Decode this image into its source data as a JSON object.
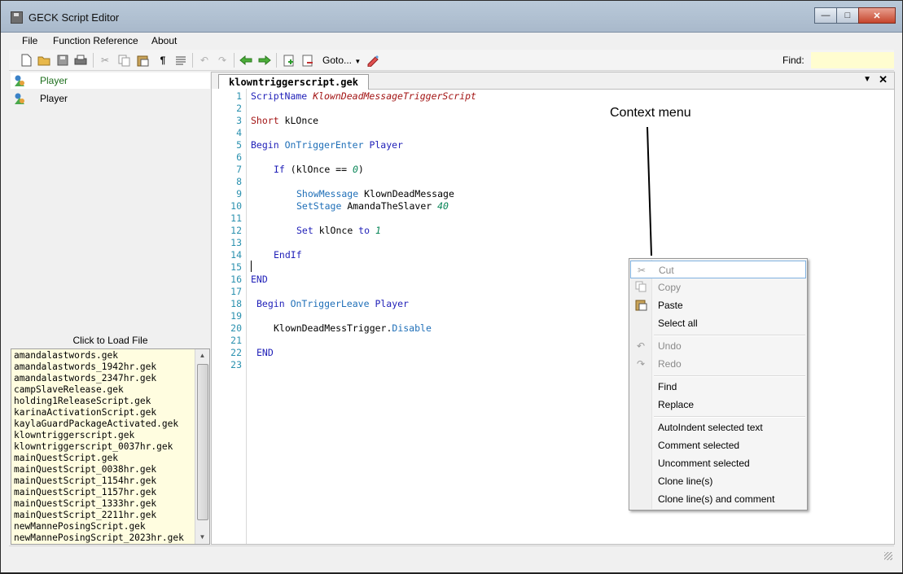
{
  "window": {
    "title": "GECK Script Editor"
  },
  "menu": [
    "File",
    "Function Reference",
    "About"
  ],
  "toolbar": {
    "goto_label": "Goto...",
    "find_label": "Find:",
    "find_value": ""
  },
  "objects": [
    "Player",
    "Player"
  ],
  "click_to_load": "Click to Load File",
  "files": [
    "amandalastwords.gek",
    "amandalastwords_1942hr.gek",
    "amandalastwords_2347hr.gek",
    "campSlaveRelease.gek",
    "holding1ReleaseScript.gek",
    "karinaActivationScript.gek",
    "kaylaGuardPackageActivated.gek",
    "klowntriggerscript.gek",
    "klowntriggerscript_0037hr.gek",
    "mainQuestScript.gek",
    "mainQuestScript_0038hr.gek",
    "mainQuestScript_1154hr.gek",
    "mainQuestScript_1157hr.gek",
    "mainQuestScript_1333hr.gek",
    "mainQuestScript_2211hr.gek",
    "newMannePosingScript.gek",
    "newMannePosingScript_2023hr.gek"
  ],
  "editor": {
    "tab_label": "klowntriggerscript.gek",
    "line_numbers": [
      "1",
      "2",
      "3",
      "4",
      "5",
      "6",
      "7",
      "8",
      "9",
      "10",
      "11",
      "12",
      "13",
      "14",
      "15",
      "16",
      "17",
      "18",
      "19",
      "20",
      "21",
      "22",
      "23"
    ]
  },
  "annotation": "Context menu",
  "context_menu": {
    "cut": "Cut",
    "copy": "Copy",
    "paste": "Paste",
    "select_all": "Select all",
    "undo": "Undo",
    "redo": "Redo",
    "find": "Find",
    "replace": "Replace",
    "autoindent": "AutoIndent selected text",
    "comment": "Comment selected",
    "uncomment": "Uncomment selected",
    "clone": "Clone line(s)",
    "clone_comment": "Clone line(s) and comment"
  },
  "code_tokens": {
    "l1a": "ScriptName",
    "l1b": "KlownDeadMessageTriggerScript",
    "l3a": "Short",
    "l3b": " kLOnce",
    "l5a": "Begin",
    "l5b": "OnTriggerEnter",
    "l5c": "Player",
    "l7a": "If",
    "l7b": " (klOnce == ",
    "l7c": "0",
    "l7d": ")",
    "l9a": "ShowMessage",
    "l9b": " KlownDeadMessage",
    "l10a": "SetStage",
    "l10b": " AmandaTheSlaver ",
    "l10c": "40",
    "l12a": "Set",
    "l12b": " klOnce ",
    "l12c": "to",
    "l12d": "1",
    "l14a": "EndIf",
    "l16a": "END",
    "l18a": "Begin",
    "l18b": "OnTriggerLeave",
    "l18c": "Player",
    "l20a": "KlownDeadMessTrigger.",
    "l20b": "Disable",
    "l22a": "END"
  },
  "colors": {
    "keyword_blue": "#1f1fb8",
    "keyword_red": "#a31515",
    "script_name": "#a31515",
    "function_teal": "#1f6fb8",
    "number_green": "#098658",
    "line_number": "#2b91af",
    "file_list_bg": "#fffde0"
  }
}
